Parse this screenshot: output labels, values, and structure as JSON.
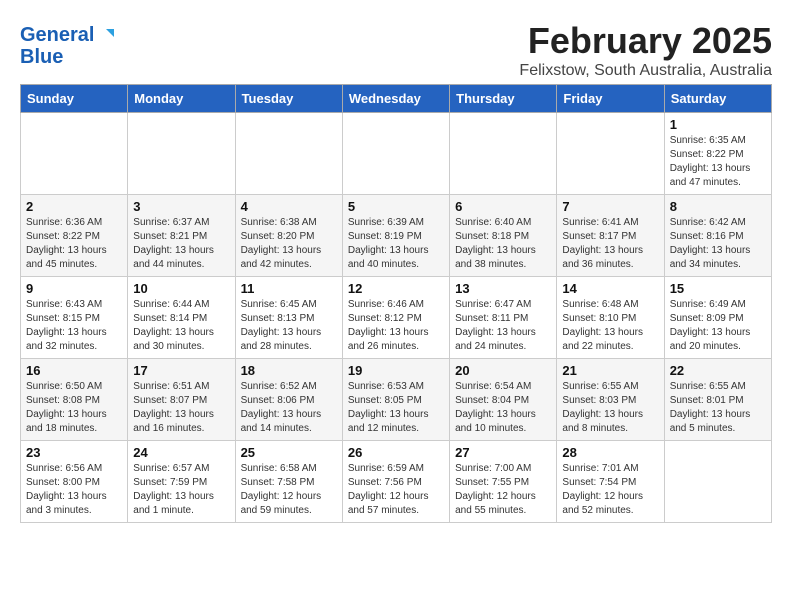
{
  "header": {
    "logo_general": "General",
    "logo_blue": "Blue",
    "title": "February 2025",
    "location": "Felixstow, South Australia, Australia"
  },
  "weekdays": [
    "Sunday",
    "Monday",
    "Tuesday",
    "Wednesday",
    "Thursday",
    "Friday",
    "Saturday"
  ],
  "weeks": [
    [
      {
        "day": "",
        "info": ""
      },
      {
        "day": "",
        "info": ""
      },
      {
        "day": "",
        "info": ""
      },
      {
        "day": "",
        "info": ""
      },
      {
        "day": "",
        "info": ""
      },
      {
        "day": "",
        "info": ""
      },
      {
        "day": "1",
        "info": "Sunrise: 6:35 AM\nSunset: 8:22 PM\nDaylight: 13 hours and 47 minutes."
      }
    ],
    [
      {
        "day": "2",
        "info": "Sunrise: 6:36 AM\nSunset: 8:22 PM\nDaylight: 13 hours and 45 minutes."
      },
      {
        "day": "3",
        "info": "Sunrise: 6:37 AM\nSunset: 8:21 PM\nDaylight: 13 hours and 44 minutes."
      },
      {
        "day": "4",
        "info": "Sunrise: 6:38 AM\nSunset: 8:20 PM\nDaylight: 13 hours and 42 minutes."
      },
      {
        "day": "5",
        "info": "Sunrise: 6:39 AM\nSunset: 8:19 PM\nDaylight: 13 hours and 40 minutes."
      },
      {
        "day": "6",
        "info": "Sunrise: 6:40 AM\nSunset: 8:18 PM\nDaylight: 13 hours and 38 minutes."
      },
      {
        "day": "7",
        "info": "Sunrise: 6:41 AM\nSunset: 8:17 PM\nDaylight: 13 hours and 36 minutes."
      },
      {
        "day": "8",
        "info": "Sunrise: 6:42 AM\nSunset: 8:16 PM\nDaylight: 13 hours and 34 minutes."
      }
    ],
    [
      {
        "day": "9",
        "info": "Sunrise: 6:43 AM\nSunset: 8:15 PM\nDaylight: 13 hours and 32 minutes."
      },
      {
        "day": "10",
        "info": "Sunrise: 6:44 AM\nSunset: 8:14 PM\nDaylight: 13 hours and 30 minutes."
      },
      {
        "day": "11",
        "info": "Sunrise: 6:45 AM\nSunset: 8:13 PM\nDaylight: 13 hours and 28 minutes."
      },
      {
        "day": "12",
        "info": "Sunrise: 6:46 AM\nSunset: 8:12 PM\nDaylight: 13 hours and 26 minutes."
      },
      {
        "day": "13",
        "info": "Sunrise: 6:47 AM\nSunset: 8:11 PM\nDaylight: 13 hours and 24 minutes."
      },
      {
        "day": "14",
        "info": "Sunrise: 6:48 AM\nSunset: 8:10 PM\nDaylight: 13 hours and 22 minutes."
      },
      {
        "day": "15",
        "info": "Sunrise: 6:49 AM\nSunset: 8:09 PM\nDaylight: 13 hours and 20 minutes."
      }
    ],
    [
      {
        "day": "16",
        "info": "Sunrise: 6:50 AM\nSunset: 8:08 PM\nDaylight: 13 hours and 18 minutes."
      },
      {
        "day": "17",
        "info": "Sunrise: 6:51 AM\nSunset: 8:07 PM\nDaylight: 13 hours and 16 minutes."
      },
      {
        "day": "18",
        "info": "Sunrise: 6:52 AM\nSunset: 8:06 PM\nDaylight: 13 hours and 14 minutes."
      },
      {
        "day": "19",
        "info": "Sunrise: 6:53 AM\nSunset: 8:05 PM\nDaylight: 13 hours and 12 minutes."
      },
      {
        "day": "20",
        "info": "Sunrise: 6:54 AM\nSunset: 8:04 PM\nDaylight: 13 hours and 10 minutes."
      },
      {
        "day": "21",
        "info": "Sunrise: 6:55 AM\nSunset: 8:03 PM\nDaylight: 13 hours and 8 minutes."
      },
      {
        "day": "22",
        "info": "Sunrise: 6:55 AM\nSunset: 8:01 PM\nDaylight: 13 hours and 5 minutes."
      }
    ],
    [
      {
        "day": "23",
        "info": "Sunrise: 6:56 AM\nSunset: 8:00 PM\nDaylight: 13 hours and 3 minutes."
      },
      {
        "day": "24",
        "info": "Sunrise: 6:57 AM\nSunset: 7:59 PM\nDaylight: 13 hours and 1 minute."
      },
      {
        "day": "25",
        "info": "Sunrise: 6:58 AM\nSunset: 7:58 PM\nDaylight: 12 hours and 59 minutes."
      },
      {
        "day": "26",
        "info": "Sunrise: 6:59 AM\nSunset: 7:56 PM\nDaylight: 12 hours and 57 minutes."
      },
      {
        "day": "27",
        "info": "Sunrise: 7:00 AM\nSunset: 7:55 PM\nDaylight: 12 hours and 55 minutes."
      },
      {
        "day": "28",
        "info": "Sunrise: 7:01 AM\nSunset: 7:54 PM\nDaylight: 12 hours and 52 minutes."
      },
      {
        "day": "",
        "info": ""
      }
    ]
  ]
}
